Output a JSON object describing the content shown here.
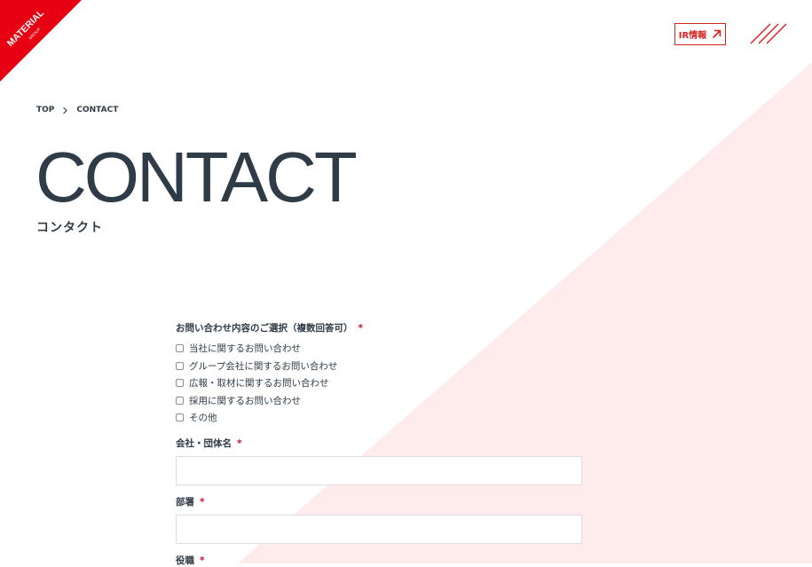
{
  "brand": {
    "logo_text": "MATERIAL",
    "logo_sub": "GROUP",
    "accent_color": "#e60012",
    "tint_color": "#fdeceb"
  },
  "header": {
    "ir_label": "IR情報",
    "ir_icon": "arrow-up-right-icon",
    "menu_icon": "hamburger-slash-icon"
  },
  "breadcrumb": {
    "home": "TOP",
    "current": "CONTACT"
  },
  "page": {
    "title": "CONTACT",
    "subtitle": "コンタクト"
  },
  "form": {
    "inquiry": {
      "label": "お問い合わせ内容のご選択（複数回答可）",
      "required_mark": "*",
      "options": [
        "当社に関するお問い合わせ",
        "グループ会社に関するお問い合わせ",
        "広報・取材に関するお問い合わせ",
        "採用に関するお問い合わせ",
        "その他"
      ]
    },
    "company": {
      "label": "会社・団体名",
      "required_mark": "*",
      "value": ""
    },
    "department": {
      "label": "部署",
      "required_mark": "*",
      "value": ""
    },
    "position": {
      "label": "役職",
      "required_mark": "*"
    }
  }
}
